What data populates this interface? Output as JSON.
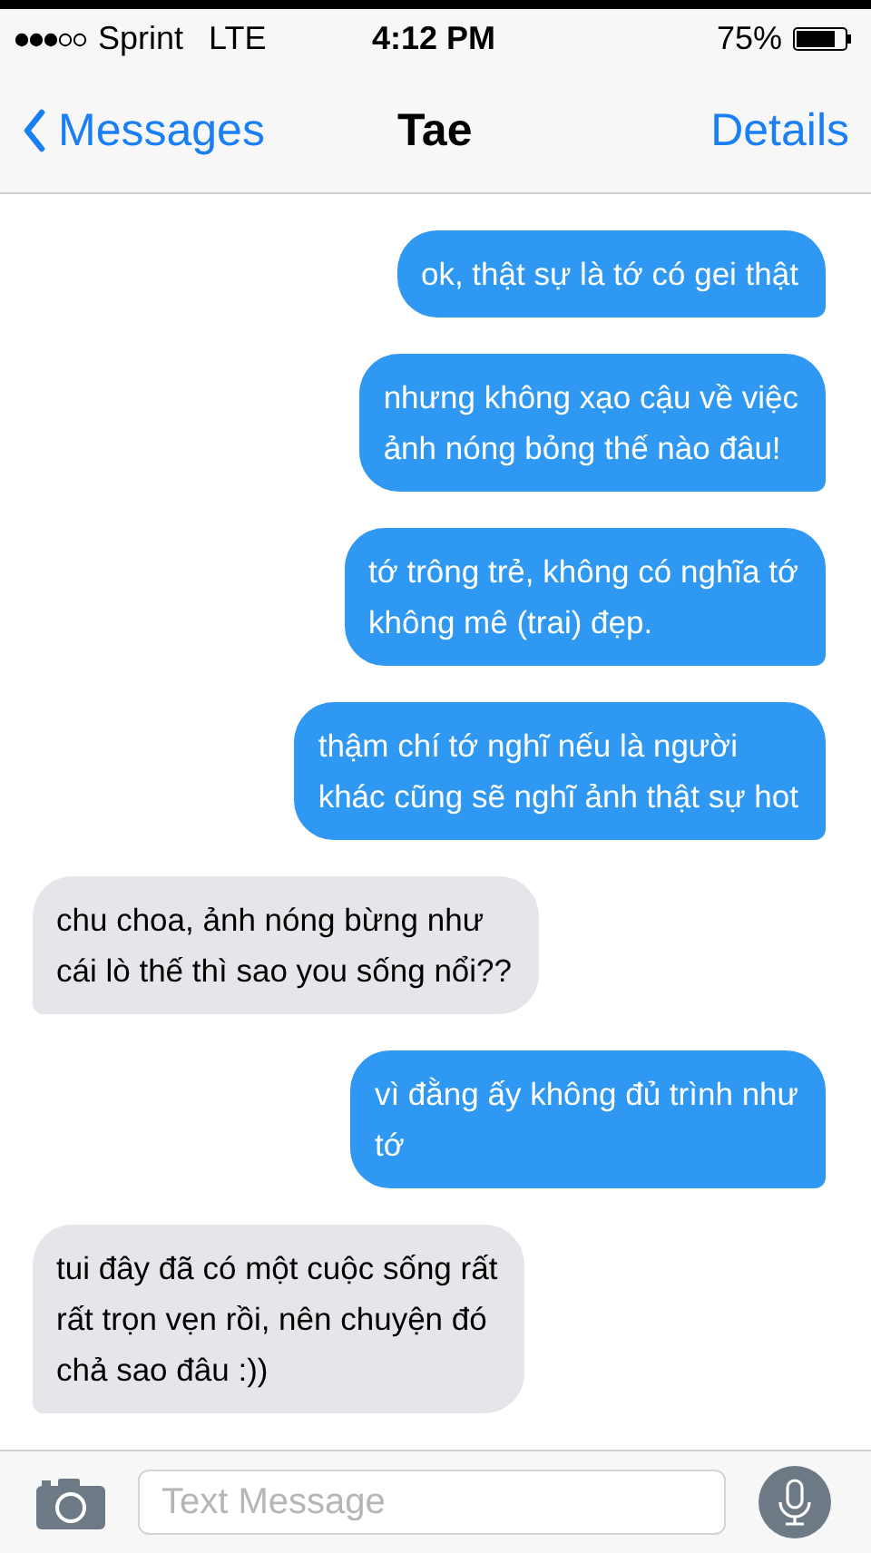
{
  "status_bar": {
    "carrier": "Sprint",
    "network": "LTE",
    "time": "4:12 PM",
    "battery": "75%"
  },
  "nav": {
    "back": "Messages",
    "title": "Tae",
    "action": "Details"
  },
  "messages": [
    {
      "kind": "sent",
      "text": "ok, thật sự là tớ có gei thật"
    },
    {
      "kind": "sent",
      "text": "nhưng không xạo cậu về việc\nảnh nóng bỏng thế nào đâu!"
    },
    {
      "kind": "sent",
      "text": "tớ trông trẻ, không có nghĩa tớ\nkhông mê (trai) đẹp."
    },
    {
      "kind": "sent",
      "text": "thậm chí tớ nghĩ nếu là người\nkhác cũng sẽ nghĩ ảnh thật sự hot"
    },
    {
      "kind": "received",
      "text": "chu choa, ảnh nóng bừng như\ncái lò thế thì sao you sống nổi??"
    },
    {
      "kind": "sent",
      "text": "vì đằng ấy không đủ trình như\ntớ"
    },
    {
      "kind": "received",
      "text": "tui đây đã có một cuộc sống rất\nrất trọn vẹn rồi, nên chuyện đó\nchả sao đâu :))"
    }
  ],
  "composer": {
    "placeholder": "Text Message"
  }
}
